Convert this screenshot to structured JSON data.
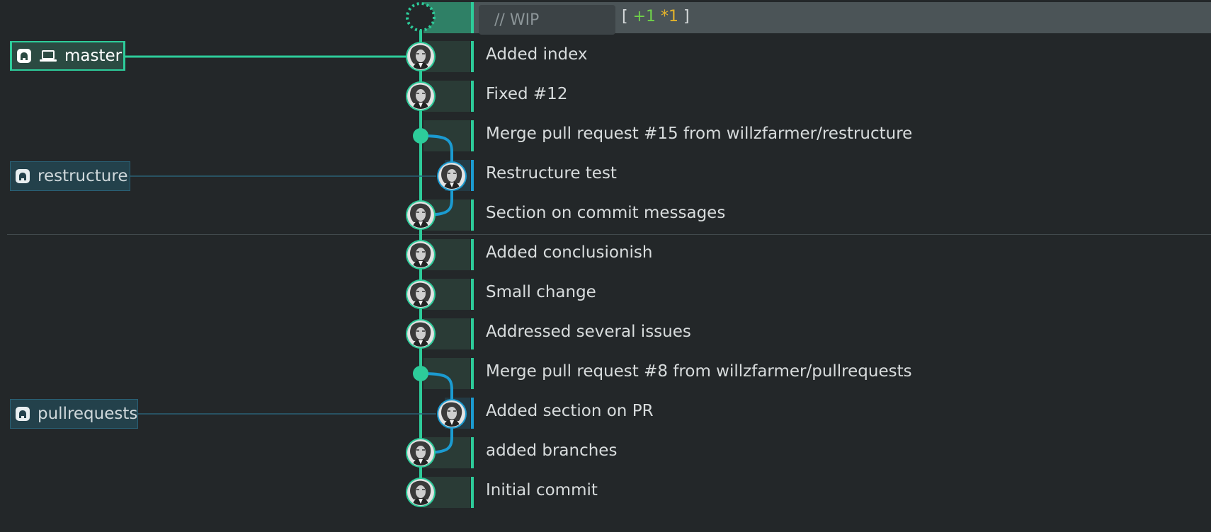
{
  "wip": {
    "placeholder": "// WIP",
    "bracket_open": "[",
    "added": "+1",
    "modified": "*1",
    "bracket_close": "]"
  },
  "refs": {
    "master": "master",
    "restructure": "restructure",
    "pullrequests": "pullrequests"
  },
  "commits": [
    {
      "message": "Added index"
    },
    {
      "message": "Fixed #12"
    },
    {
      "message": "Merge pull request #15 from willzfarmer/restructure"
    },
    {
      "message": "Restructure test"
    },
    {
      "message": "Section on commit messages"
    },
    {
      "message": "Added conclusionish"
    },
    {
      "message": "Small change"
    },
    {
      "message": "Addressed several issues"
    },
    {
      "message": "Merge pull request #8 from willzfarmer/pullrequests"
    },
    {
      "message": "Added section on PR"
    },
    {
      "message": "added branches"
    },
    {
      "message": "Initial commit"
    }
  ],
  "colors": {
    "master_lane": "#2dcc9a",
    "branch_lane": "#1b9bd1",
    "background": "#232729"
  }
}
